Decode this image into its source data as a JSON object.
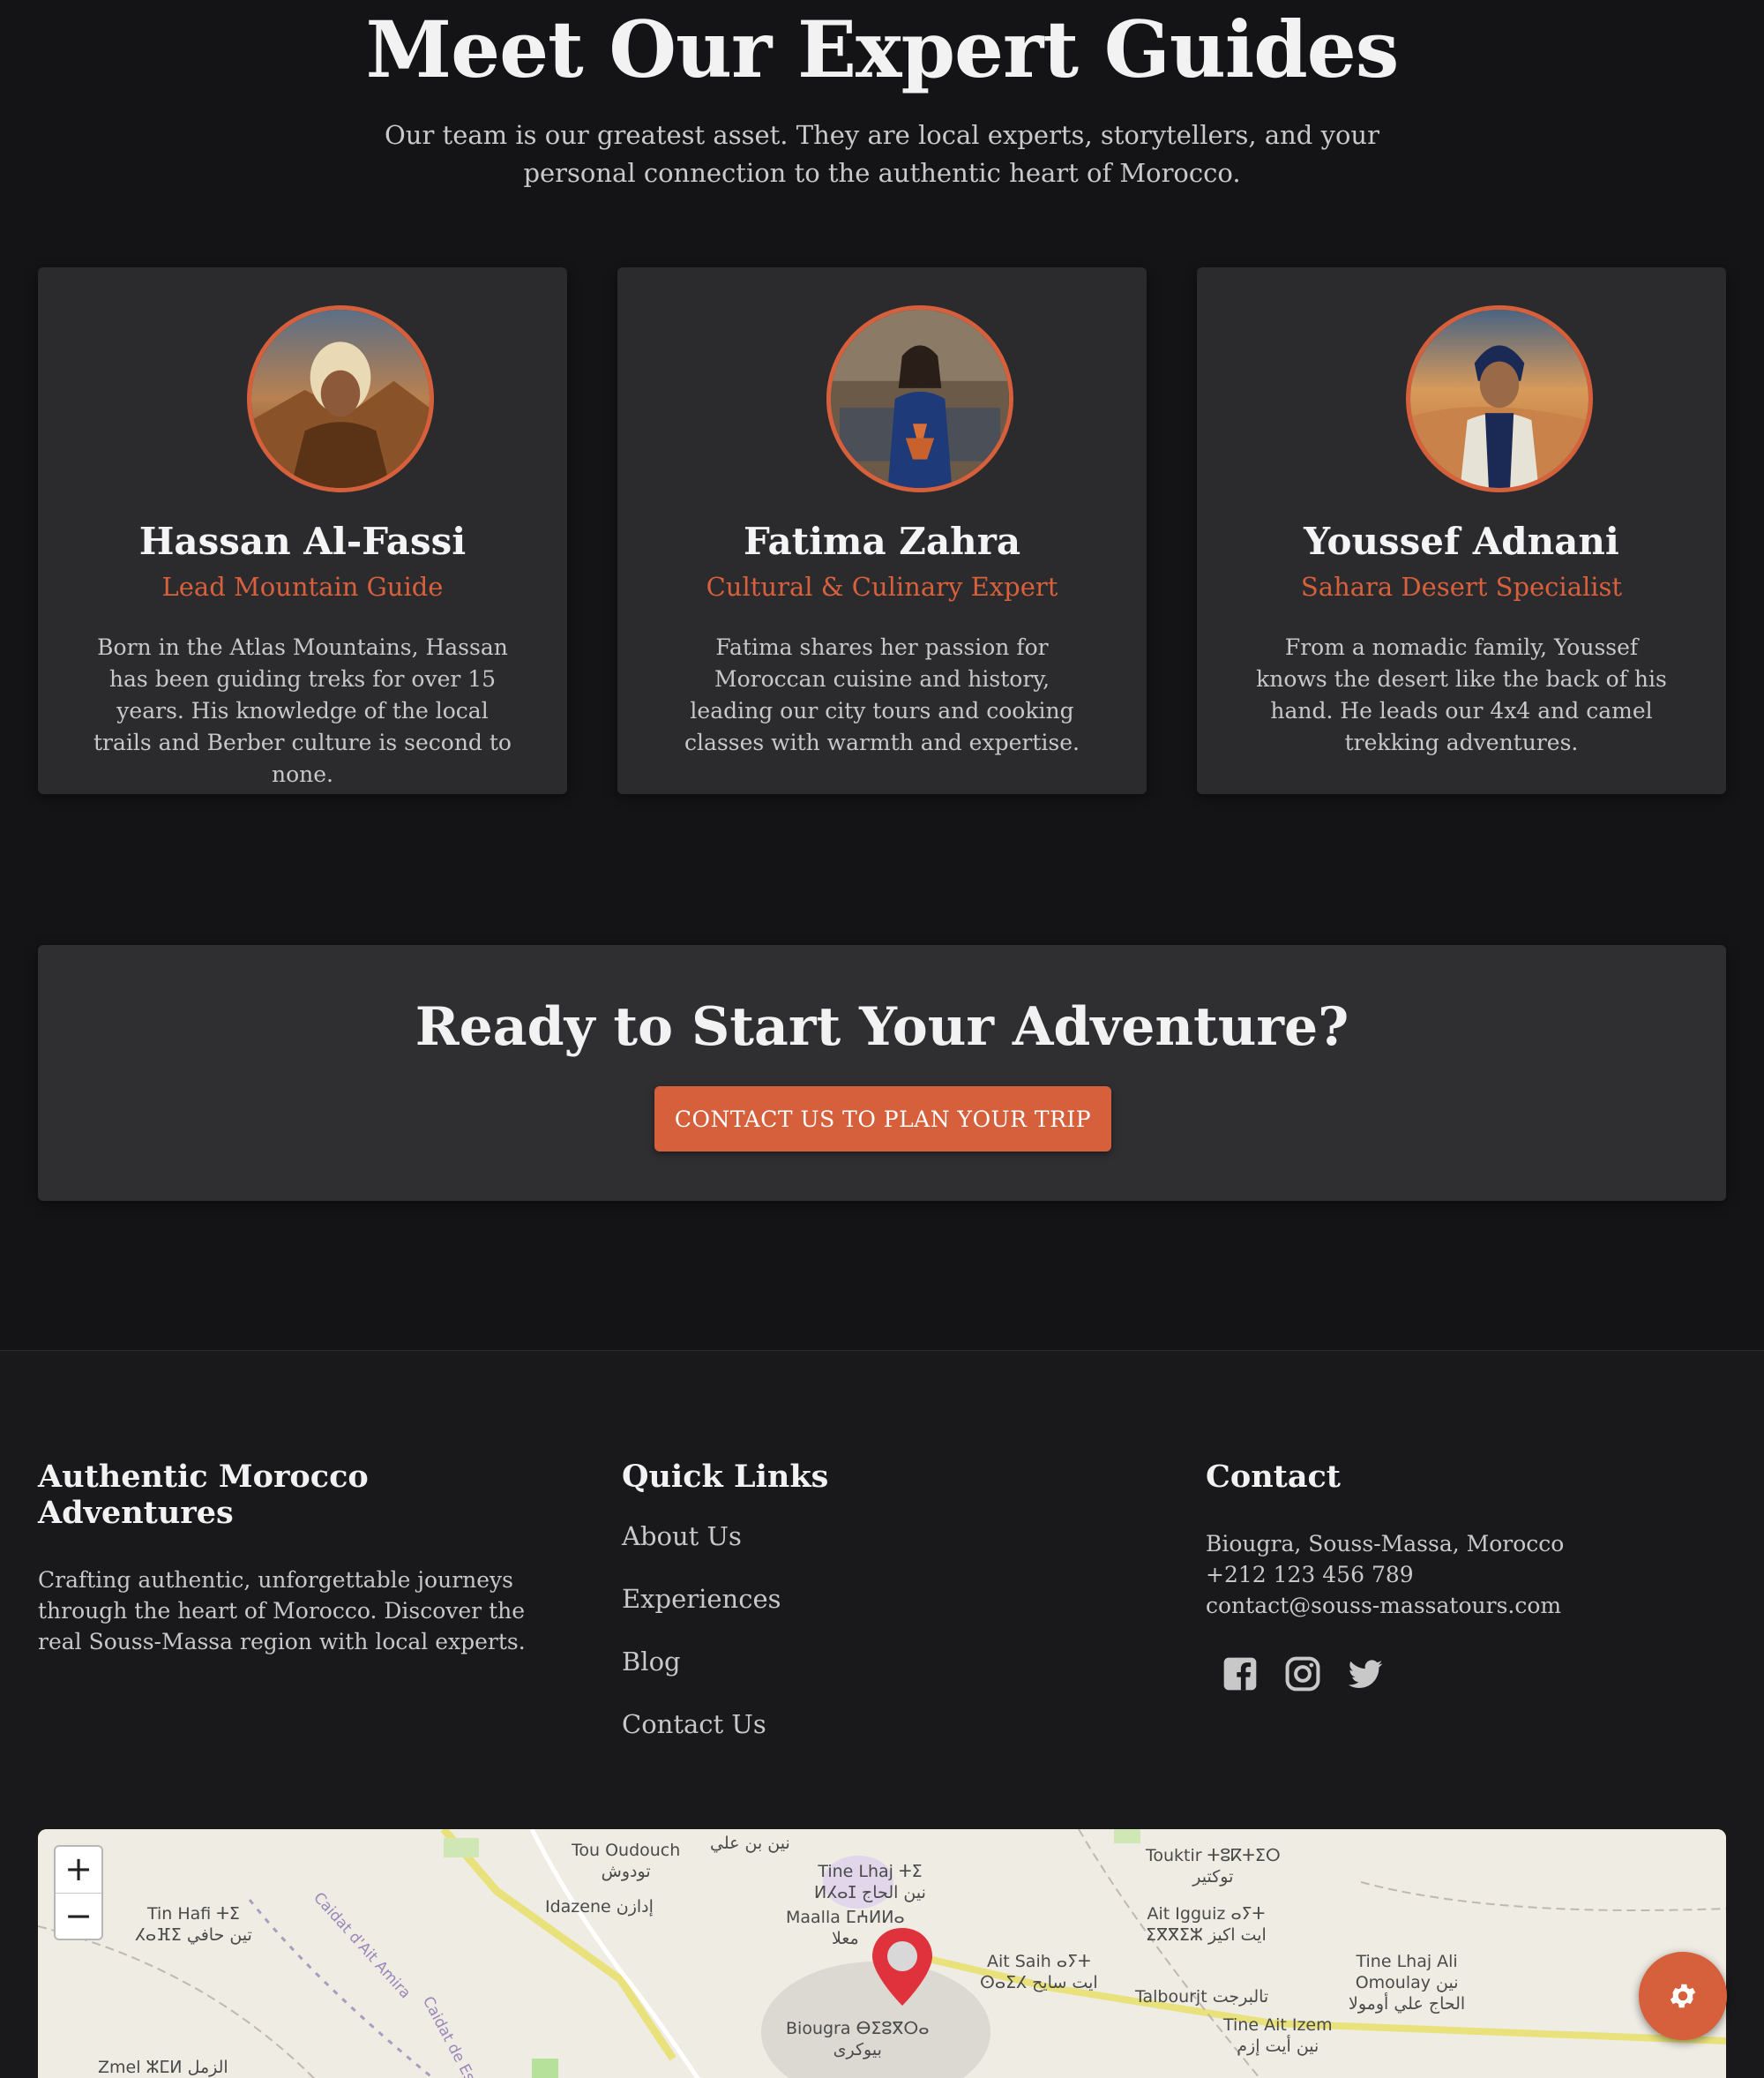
{
  "guides_section": {
    "title": "Meet Our Expert Guides",
    "subtitle": "Our team is our greatest asset. They are local experts, storytellers, and your personal connection to the authentic heart of Morocco."
  },
  "guides": [
    {
      "name": "Hassan Al-Fassi",
      "role": "Lead Mountain Guide",
      "bio": "Born in the Atlas Mountains, Hassan has been guiding treks for over 15 years. His knowledge of the local trails and Berber culture is second to none."
    },
    {
      "name": "Fatima Zahra",
      "role": "Cultural & Culinary Expert",
      "bio": "Fatima shares her passion for Moroccan cuisine and history, leading our city tours and cooking classes with warmth and expertise."
    },
    {
      "name": "Youssef Adnani",
      "role": "Sahara Desert Specialist",
      "bio": "From a nomadic family, Youssef knows the desert like the back of his hand. He leads our 4x4 and camel trekking adventures."
    }
  ],
  "cta": {
    "title": "Ready to Start Your Adventure?",
    "button": "CONTACT US TO PLAN YOUR TRIP"
  },
  "footer": {
    "about": {
      "heading": "Authentic Morocco Adventures",
      "text": "Crafting authentic, unforgettable journeys through the heart of Morocco. Discover the real Souss-Massa region with local experts."
    },
    "quick_links": {
      "heading": "Quick Links",
      "items": [
        "About Us",
        "Experiences",
        "Blog",
        "Contact Us"
      ]
    },
    "contact": {
      "heading": "Contact",
      "address": "Biougra, Souss-Massa, Morocco",
      "phone": "+212 123 456 789",
      "email": "contact@souss-massatours.com",
      "socials": [
        "facebook-icon",
        "instagram-icon",
        "twitter-icon"
      ]
    }
  },
  "map": {
    "zoom_in": "+",
    "zoom_out": "−",
    "labels": [
      "Tou Oudouch\nتودوش",
      "نين بن علي",
      "Tine Lhaj ⵜⵉ\nⵍⵃⴰⵊ نين الحاج",
      "Idazene إدازن",
      "Maalla ⵎⵄⵍⵍⴰ\nمعلا",
      "Tin Hafi ⵜⵉ\nⵃⴰⴼⵉ تين حافي",
      "Touktir ⵜⵓⴽⵜⵉⵔ\nتوكتير",
      "Ait Igguiz ⴰⵢⵜ\nⵉⴳⴳⵉⵣ ايت اكيز",
      "Ait Saih ⴰⵢⵜ\nⵙⴰⵉⵃ ايت سايح",
      "Tine Lhaj Ali\nOmoulay نين\nالحاج علي أومولا",
      "Talbourjt تالبرجت",
      "Tine Ait Izem\nنين أيت إزم",
      "Biougra ⴱⵉⵓⴳⵔⴰ\nبيوكرى",
      "Zmel ⵣⵎⵍ الزمل",
      "Caidat d'Ait Amira",
      "Caidat de Ess"
    ]
  },
  "settings_fab": "gear-icon",
  "colors": {
    "accent": "#d65f3c",
    "background": "#141416",
    "card": "#2b2b2e"
  }
}
